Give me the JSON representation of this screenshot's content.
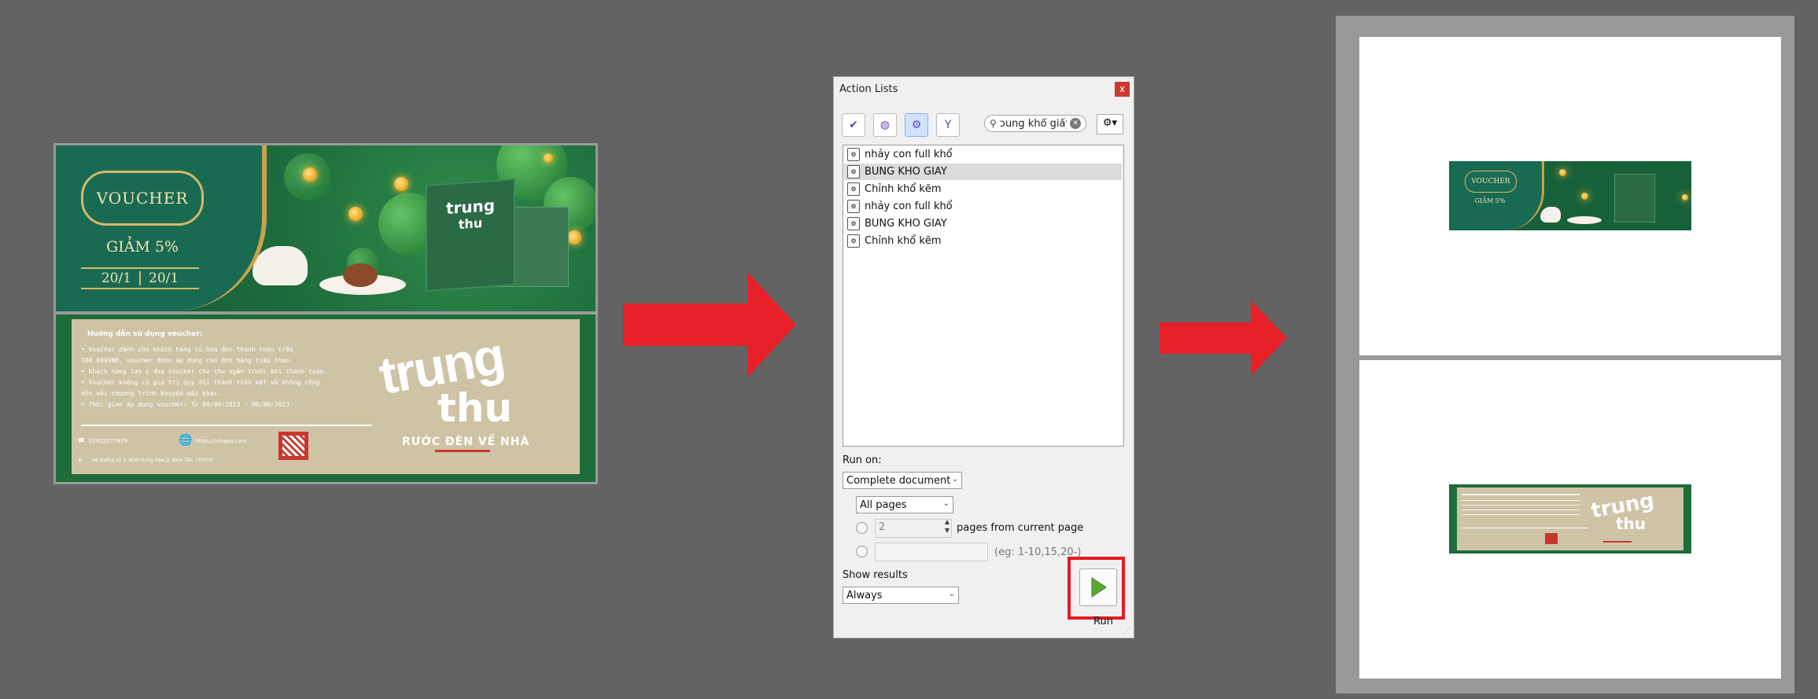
{
  "voucher": {
    "badge": "VOUCHER",
    "discount": "GIẢM 5%",
    "date_from": "20/1",
    "date_to": "20/1",
    "guide_title": "Hướng dẫn sử dụng voucher:",
    "guide_lines": [
      "• Voucher dành cho khách hàng có hóa đơn thanh toán trên",
      "  100.000VNĐ, voucher được áp dụng cho đơn hàng tiếp theo.",
      "• Khách hàng lưu ý đưa voucher cho thu ngân trước khi thanh toán.",
      "• Voucher không có giá trị quy đổi thành tiền mặt và không cộng",
      "  dồn với chương trình khuyến mãi khác.",
      "• Thời gian áp dụng voucher: Từ 00/00/2023 - 00/00/2023"
    ],
    "phone": "02822077979",
    "website": "https://vinapo.com",
    "address": "66 đường số 3, Bình Hưng Hòa Q. Bình Tân, TP.HCM",
    "brand_big": "trung",
    "brand_mid": "thu",
    "brand_sub": "RƯỚC ĐÈN VỀ NHÀ"
  },
  "dialog": {
    "title": "Action Lists",
    "close": "x",
    "search_value": "ɔung khổ giấy",
    "items": [
      "nhảy con full khổ",
      "BUNG KHO GIAY",
      "Chỉnh khổ kẽm",
      "nhảy con full khổ",
      "BUNG KHO GIAY",
      "Chỉnh khổ kẽm"
    ],
    "selected_index": 1,
    "run_on_label": "Run on:",
    "run_on_value": "Complete document",
    "pages_value": "All pages",
    "pages_count": "2",
    "pages_from_label": "pages from current page",
    "range_hint": "(eg: 1-10,15,20-)",
    "show_results_label": "Show results",
    "show_results_value": "Always",
    "run_label": "Run"
  },
  "colors": {
    "arrow": "#e8202a",
    "highlight_box": "#e31b23",
    "voucher_green": "#1f6b3a",
    "gold": "#d8b867"
  }
}
